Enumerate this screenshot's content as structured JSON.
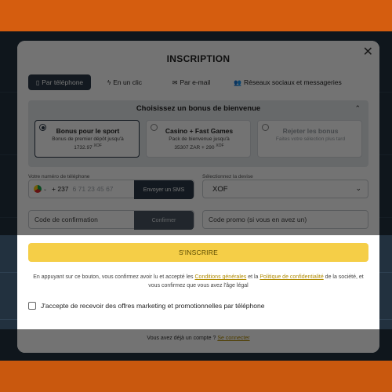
{
  "modal": {
    "title": "INSCRIPTION",
    "close_icon": "close-icon"
  },
  "tabs": [
    {
      "label": "Par téléphone",
      "icon": "phone-icon",
      "active": true
    },
    {
      "label": "En un clic",
      "icon": "lightning-icon",
      "active": false
    },
    {
      "label": "Par e-mail",
      "icon": "envelope-icon",
      "active": false
    },
    {
      "label": "Réseaux sociaux et messageries",
      "icon": "users-icon",
      "active": false
    }
  ],
  "bonus": {
    "heading": "Choisissez un bonus de bienvenue",
    "options": [
      {
        "title": "Bonus pour le sport",
        "line1": "Bonus de premier dépôt jusqu'à",
        "line2": "1732.97",
        "currency": "XOF",
        "selected": true
      },
      {
        "title": "Casino + Fast Games",
        "line1": "Pack de bienvenue jusqu'à",
        "line2": "35307 ZAR + 290",
        "currency": "XOF",
        "selected": false
      },
      {
        "title": "Rejeter les bonus",
        "line1": "Faites votre sélection plus tard",
        "line2": "",
        "currency": "",
        "selected": false,
        "disabled": true
      }
    ]
  },
  "phone": {
    "label": "Votre numéro de téléphone",
    "prefix": "+ 237",
    "placeholder": "6 71 23 45 67",
    "send_sms_label": "Envoyer un SMS"
  },
  "currency": {
    "label": "Sélectionnez la devise",
    "value": "XOF"
  },
  "code": {
    "placeholder": "Code de confirmation",
    "confirm_label": "Confirmer"
  },
  "promo": {
    "placeholder": "Code promo (si vous en avez un)"
  },
  "submit_label": "S'INSCRIRE",
  "terms": {
    "part1": "En appuyant sur ce bouton, vous confirmez avoir lu et accepté les ",
    "link1": "Conditions générales",
    "part2": " et la ",
    "link2": "Politique de confidentialité",
    "part3": " de la société, et vous confirmez que vous avez l'âge légal"
  },
  "marketing_label": "J'accepte de recevoir des offres marketing et promotionnelles par téléphone",
  "login": {
    "text": "Vous avez déjà un compte ? ",
    "link": "Se connecter"
  },
  "colors": {
    "accent_yellow": "#f5ce47",
    "dark_navy": "#2a3947",
    "link_gold": "#b08a00",
    "header_orange": "#d55d0f"
  }
}
